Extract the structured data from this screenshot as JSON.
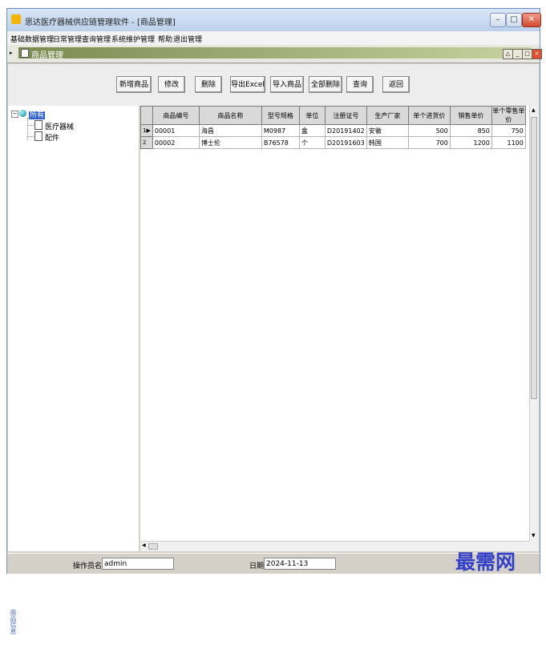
{
  "window": {
    "title": "思达医疗器械供应链管理软件 - [商品管理]"
  },
  "menu": [
    "基础数据管理",
    "日常管理",
    "查询管理",
    "系统维护管理",
    "帮助",
    "退出管理"
  ],
  "mdi": {
    "caption": "商品管理"
  },
  "toolbar": {
    "buttons": [
      "新增商品",
      "修改",
      "删除",
      "导出Excel",
      "导入商品",
      "全部删除",
      "查询",
      "返回"
    ]
  },
  "tree": {
    "root": "所有",
    "children": [
      "医疗器械",
      "配件"
    ]
  },
  "side_tab": "商品信息",
  "grid": {
    "columns": [
      "商品编号",
      "商品名称",
      "型号规格",
      "单位",
      "注册证号",
      "生产厂家",
      "单个进货价",
      "销售单价",
      "单个零售单价"
    ],
    "rows": [
      {
        "index": "1",
        "id": "00001",
        "name": "海昌",
        "model": "M0987",
        "unit": "盒",
        "reg": "D20191402",
        "maker": "安徽",
        "cost": "500",
        "price": "850",
        "retail": "750"
      },
      {
        "index": "2",
        "id": "00002",
        "name": "博士伦",
        "model": "B76578",
        "unit": "个",
        "reg": "D20191603",
        "maker": "韩国",
        "cost": "700",
        "price": "1200",
        "retail": "1100"
      }
    ]
  },
  "status": {
    "operator_label": "操作员名",
    "operator_value": "admin",
    "date_label": "日期",
    "date_value": "2024-11-13"
  },
  "watermark": "最需网"
}
